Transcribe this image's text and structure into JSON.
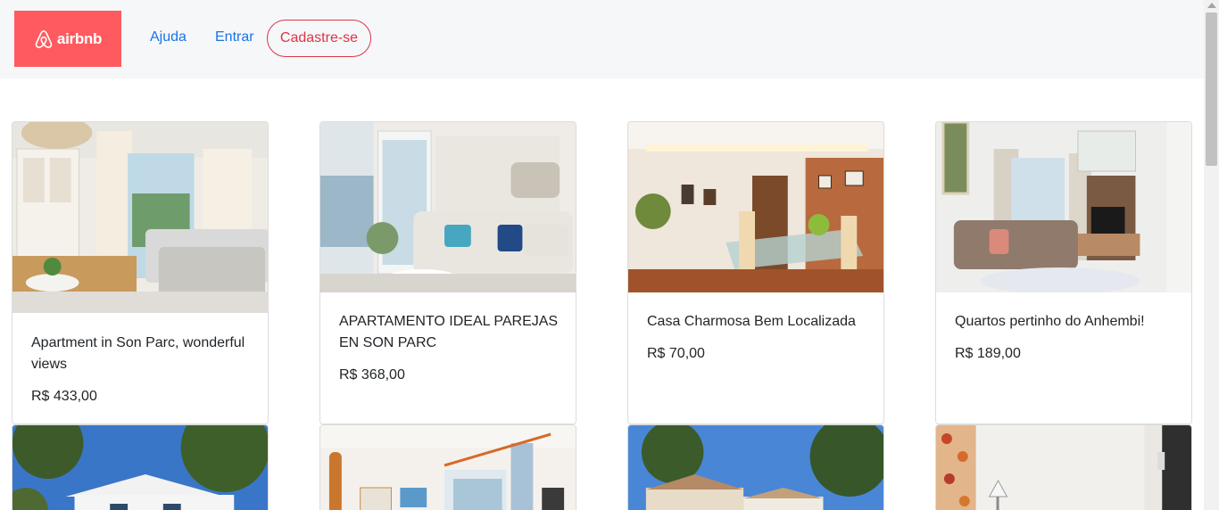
{
  "nav": {
    "brand": "airbnb",
    "help": "Ajuda",
    "login": "Entrar",
    "signup": "Cadastre-se"
  },
  "colors": {
    "brand": "#ff5a5f",
    "link": "#1a73e8",
    "signup": "#dc3545"
  },
  "listings": [
    {
      "title": "Apartment in Son Parc, wonderful views",
      "price": "R$ 433,00"
    },
    {
      "title": "APARTAMENTO IDEAL PAREJAS EN SON PARC",
      "price": "R$ 368,00"
    },
    {
      "title": "Casa Charmosa Bem Localizada",
      "price": "R$ 70,00"
    },
    {
      "title": "Quartos pertinho do Anhembi!",
      "price": "R$ 189,00"
    }
  ]
}
